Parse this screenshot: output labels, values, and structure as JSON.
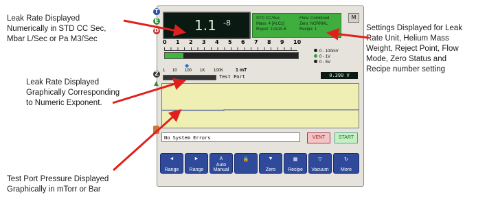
{
  "callouts": {
    "leak_rate_numeric": [
      "Leak Rate Displayed",
      "Numerically in STD CC Sec,",
      "Mbar L/Sec or Pa M3/Sec"
    ],
    "settings": [
      "Settings Displayed for Leak",
      "Rate Unit, Helium Mass",
      "Weight, Reject Point, Flow",
      "Mode, Zero Status and",
      "Recipe number setting"
    ],
    "leak_rate_graphic": [
      "Leak Rate Displayed",
      "Graphically Corresponding",
      "to Numeric Exponent."
    ],
    "test_port": [
      "Test Port Pressure Displayed",
      "Graphically in mTorr or Bar"
    ]
  },
  "sidebar": {
    "icons": [
      {
        "name": "t-icon",
        "glyph": "T",
        "color": "#2a4fa0"
      },
      {
        "name": "e-icon",
        "glyph": "E",
        "color": "#2f8f3a"
      },
      {
        "name": "d-icon",
        "glyph": "D",
        "color": "#c03030"
      },
      {
        "name": "z-icon",
        "glyph": "Z",
        "color": "#333333"
      }
    ]
  },
  "readout": {
    "mantissa": "1.1",
    "exponent": "-8"
  },
  "settings_box": {
    "col1": [
      "STD CC/Sec",
      "Mass: 4 [At.Cz]",
      "Reject: 2.0x10-6"
    ],
    "col2": [
      "Flow: Combined",
      "Zero: NORMAL",
      "Recipe: 1"
    ]
  },
  "m_button": "M",
  "leak_scale": {
    "ticks": [
      "0",
      "1",
      "2",
      "3",
      "4",
      "5",
      "6",
      "7",
      "8",
      "9",
      "10"
    ],
    "fill_fraction": 0.14
  },
  "legend": [
    {
      "label": "0 - 100mV",
      "color": "#222222"
    },
    {
      "label": "0 - 1V",
      "color": "#3a9a3a"
    },
    {
      "label": "0 - 5V",
      "color": "#222222"
    }
  ],
  "pressure_scale": {
    "ticks": [
      "1",
      "10",
      "100",
      "1K",
      "100K"
    ],
    "unit_label": "1 mT",
    "port_label": "Test Port",
    "voltage": "0.390 V"
  },
  "status": {
    "message": "No System Errors",
    "vent": "VENT",
    "start": "START"
  },
  "toolbar": [
    {
      "name": "range-down-button",
      "label": "Range",
      "icon": "◄"
    },
    {
      "name": "range-up-button",
      "label": "Range",
      "icon": "►"
    },
    {
      "name": "auto-manual-button",
      "label": "Auto Manual",
      "icon": "A"
    },
    {
      "name": "lock-button",
      "label": "",
      "icon": "🔒"
    },
    {
      "name": "zero-button",
      "label": "Zero",
      "icon": "▼"
    },
    {
      "name": "recipe-button",
      "label": "Recipe",
      "icon": "▦"
    },
    {
      "name": "vacuum-button",
      "label": "Vacuum",
      "icon": "▽"
    },
    {
      "name": "more-button",
      "label": "More",
      "icon": "↻"
    }
  ],
  "colors": {
    "arrow": "#e0201c",
    "readout_bg": "#0a1a12",
    "readout_text": "#d8f0d8",
    "settings_bg": "#3fae3f",
    "graph_bg": "#efefb4",
    "vent_bg": "#f2c4c4",
    "start_bg": "#c6efc6"
  }
}
